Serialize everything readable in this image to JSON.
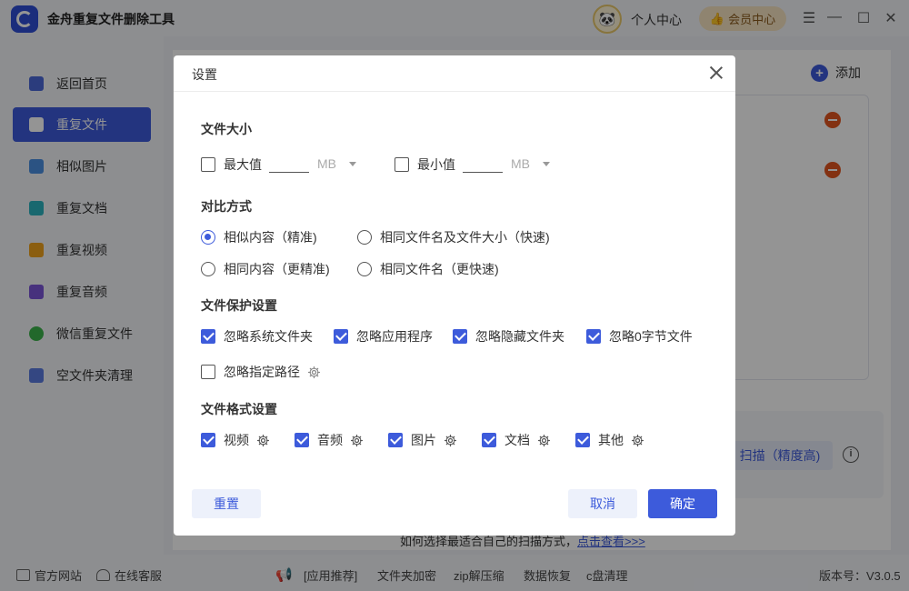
{
  "app": {
    "title": "金舟重复文件删除工具",
    "personal_center": "个人中心",
    "vip_center": "会员中心"
  },
  "sidebar": {
    "items": [
      {
        "label": "返回首页",
        "icon": "home-icon"
      },
      {
        "label": "重复文件",
        "icon": "folder-icon"
      },
      {
        "label": "相似图片",
        "icon": "image-icon"
      },
      {
        "label": "重复文档",
        "icon": "document-icon"
      },
      {
        "label": "重复视频",
        "icon": "video-icon"
      },
      {
        "label": "重复音频",
        "icon": "audio-icon"
      },
      {
        "label": "微信重复文件",
        "icon": "wechat-icon"
      },
      {
        "label": "空文件夹清理",
        "icon": "empty-folder-icon"
      }
    ]
  },
  "main": {
    "add_label": "添加",
    "scan_label": "扫描（精度高)",
    "tip_text": "如何选择最适合自己的扫描方式，",
    "tip_link": "点击查看>>>"
  },
  "footer": {
    "official_site": "官方网站",
    "online_service": "在线客服",
    "links": [
      "[应用推荐]",
      "文件夹加密",
      "zip解压缩",
      "数据恢复",
      "c盘清理"
    ],
    "version": "版本号：V3.0.5"
  },
  "dialog": {
    "title": "设置",
    "file_size": {
      "title": "文件大小",
      "max_label": "最大值",
      "max_checked": false,
      "max_value": "",
      "max_unit": "MB",
      "min_label": "最小值",
      "min_checked": false,
      "min_value": "",
      "min_unit": "MB"
    },
    "compare": {
      "title": "对比方式",
      "options": [
        {
          "label": "相似内容（精准)",
          "checked": true
        },
        {
          "label": "相同文件名及文件大小（快速)",
          "checked": false
        },
        {
          "label": "相同内容（更精准)",
          "checked": false
        },
        {
          "label": "相同文件名（更快速)",
          "checked": false
        }
      ]
    },
    "protect": {
      "title": "文件保护设置",
      "options": [
        {
          "label": "忽略系统文件夹",
          "checked": true
        },
        {
          "label": "忽略应用程序",
          "checked": true
        },
        {
          "label": "忽略隐藏文件夹",
          "checked": true
        },
        {
          "label": "忽略0字节文件",
          "checked": true
        },
        {
          "label": "忽略指定路径",
          "checked": false
        }
      ]
    },
    "formats": {
      "title": "文件格式设置",
      "options": [
        {
          "label": "视频",
          "checked": true
        },
        {
          "label": "音频",
          "checked": true
        },
        {
          "label": "图片",
          "checked": true
        },
        {
          "label": "文档",
          "checked": true
        },
        {
          "label": "其他",
          "checked": true
        }
      ]
    },
    "reset_label": "重置",
    "cancel_label": "取消",
    "ok_label": "确定"
  },
  "colors": {
    "accent": "#3d5bdb",
    "danger": "#e2551f",
    "vip_bg": "#f6e3c2"
  }
}
